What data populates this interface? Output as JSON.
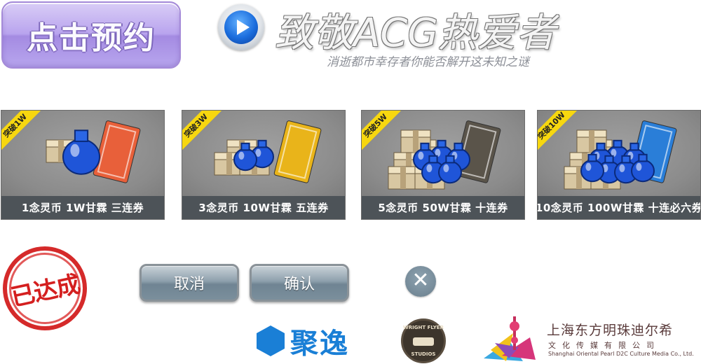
{
  "reserve_button": {
    "label": "点击预约"
  },
  "header": {
    "title": "致敬ACG热爱者",
    "subtitle": "消逝都市幸存者你能否解开这未知之谜"
  },
  "cards": [
    {
      "ribbon": "突破1W",
      "caption": "1念灵币  1W甘霖  三连券",
      "bottles": 1,
      "cash_stacks": 1,
      "ticket_color": "#e8603a"
    },
    {
      "ribbon": "突破3W",
      "caption": "3念灵币  10W甘霖  五连券",
      "bottles": 2,
      "cash_stacks": 3,
      "ticket_color": "#e9b41a"
    },
    {
      "ribbon": "突破5W",
      "caption": "5念灵币  50W甘霖  十连券",
      "bottles": 5,
      "cash_stacks": 6,
      "ticket_color": "#5a544a"
    },
    {
      "ribbon": "突破10W",
      "caption": "10念灵币  100W甘霖  十连必六券",
      "bottles": 7,
      "cash_stacks": 6,
      "ticket_color": "#2a7ed8"
    }
  ],
  "stamp": {
    "label": "已达成"
  },
  "dialog": {
    "cancel_label": "取消",
    "confirm_label": "确认",
    "close_glyph": "✕"
  },
  "logos": {
    "juyi": "聚逸",
    "wright_flyer_top": "WRIGHT FLYER",
    "wright_flyer_bottom": "STUDIOS",
    "pearl_cn": "上海东方明珠迪尔希",
    "pearl_sub": "文化传媒有限公司",
    "pearl_en": "Shanghai Oriental Pearl D2C Culture Media Co., Ltd."
  },
  "colors": {
    "reserve_purple": "#b9a4ee",
    "ribbon_yellow": "#f7d70f",
    "caption_bar": "#4d5358",
    "stamp_red": "#d52a2a",
    "juyi_blue": "#1a7fd6"
  }
}
